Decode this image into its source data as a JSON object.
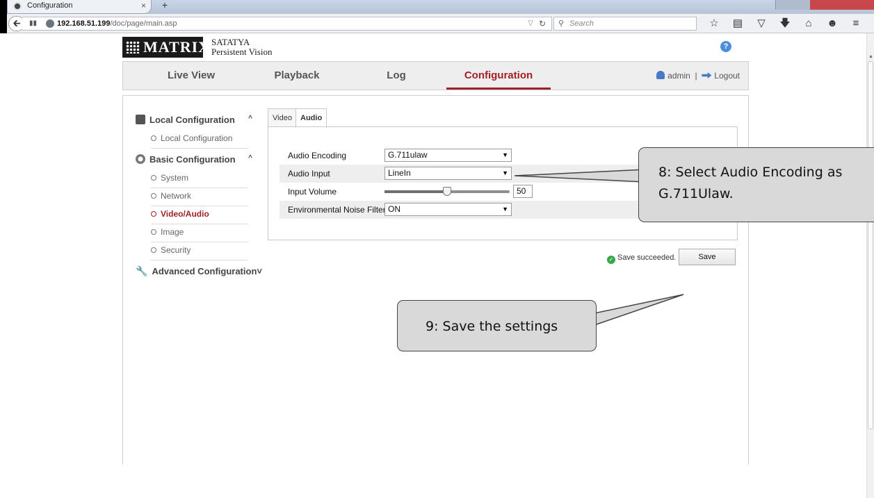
{
  "browser": {
    "tab_title": "Configuration",
    "tab_close": "×",
    "new_tab": "+",
    "url_host": "192.168.51.199",
    "url_path": "/doc/page/main.asp",
    "search_placeholder": "Search",
    "back_icon": "back-arrow-icon",
    "toolbar_icons": [
      "star-icon",
      "reading-list-icon",
      "pocket-icon",
      "download-icon",
      "home-icon",
      "chat-icon",
      "menu-icon"
    ]
  },
  "app": {
    "brand_name": "SATATYA",
    "brand_tagline": "Persistent Vision",
    "logo_text": "MATRIX",
    "help": "?",
    "nav": [
      "Live View",
      "Playback",
      "Log",
      "Configuration"
    ],
    "active_nav": "Configuration",
    "user": "admin",
    "separator": "|",
    "logout": "Logout",
    "accent_color": "#a31f25"
  },
  "sidebar": {
    "groups": [
      {
        "label": "Local Configuration",
        "caret": "^",
        "items": [
          "Local Configuration"
        ]
      },
      {
        "label": "Basic Configuration",
        "caret": "^",
        "items": [
          "System",
          "Network",
          "Video/Audio",
          "Image",
          "Security"
        ]
      },
      {
        "label": "Advanced Configuration",
        "caret": "˅",
        "items": []
      }
    ],
    "active_item": "Video/Audio"
  },
  "panel": {
    "tabs": [
      "Video",
      "Audio"
    ],
    "active_tab": "Audio",
    "fields": {
      "audio_encoding": {
        "label": "Audio Encoding",
        "value": "G.711ulaw"
      },
      "audio_input": {
        "label": "Audio Input",
        "value": "LineIn"
      },
      "input_volume": {
        "label": "Input Volume",
        "value": "50",
        "level": 0.5
      },
      "noise_filter": {
        "label": "Environmental Noise Filter",
        "value": "ON"
      }
    },
    "status": "Save succeeded.",
    "save_label": "Save"
  },
  "callouts": {
    "step8_line1": "8: Select Audio Encoding as",
    "step8_line2": "G.711Ulaw.",
    "step9": "9: Save the settings"
  }
}
